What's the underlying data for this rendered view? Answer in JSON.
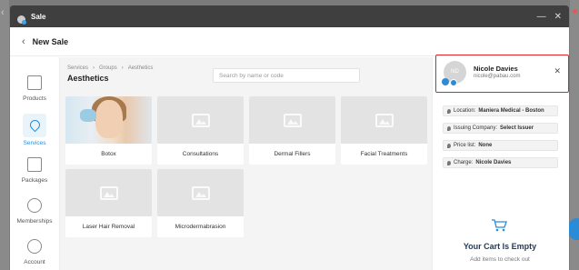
{
  "window": {
    "title": "Sale"
  },
  "page": {
    "title": "New Sale"
  },
  "sidebar": {
    "items": [
      {
        "label": "Products",
        "icon": "box-icon",
        "active": false
      },
      {
        "label": "Services",
        "icon": "tag-icon",
        "active": true
      },
      {
        "label": "Packages",
        "icon": "package-icon",
        "active": false
      },
      {
        "label": "Memberships",
        "icon": "badge-icon",
        "active": false
      },
      {
        "label": "Account",
        "icon": "dollar-icon",
        "active": false
      }
    ]
  },
  "breadcrumb": [
    "Services",
    "Groups",
    "Aesthetics"
  ],
  "section_title": "Aesthetics",
  "search": {
    "placeholder": "Search by name or code",
    "value": ""
  },
  "services": [
    {
      "label": "Botox",
      "has_photo": true
    },
    {
      "label": "Consultations",
      "has_photo": false
    },
    {
      "label": "Dermal Fillers",
      "has_photo": false
    },
    {
      "label": "Facial Treatments",
      "has_photo": false
    },
    {
      "label": "Laser Hair Removal",
      "has_photo": false
    },
    {
      "label": "Microdermabrasion",
      "has_photo": false
    }
  ],
  "client": {
    "initials": "ND",
    "name": "Nicole Davies",
    "email": "nicole@pabau.com"
  },
  "details": [
    {
      "label": "Location:",
      "value": "Maniera Medical - Boston"
    },
    {
      "label": "Issuing Company:",
      "value": "Select Issuer"
    },
    {
      "label": "Price list:",
      "value": "None"
    },
    {
      "label": "Charge:",
      "value": "Nicole Davies"
    }
  ],
  "cart": {
    "empty_title": "Your Cart Is Empty",
    "empty_subtitle": "Add items to check out"
  },
  "colors": {
    "accent": "#2a8bd6",
    "highlight": "#e02424",
    "titlebar": "#3f3f3f"
  }
}
